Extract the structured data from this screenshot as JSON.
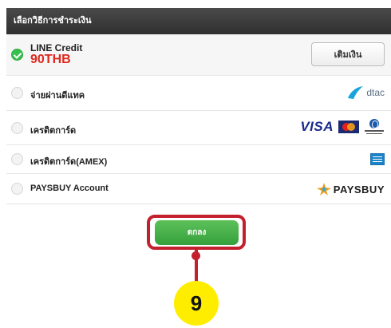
{
  "header": {
    "title": "เลือกวิธีการชำระเงิน"
  },
  "line_credit": {
    "title": "LINE Credit",
    "amount": "90THB",
    "topup_label": "เติมเงิน"
  },
  "options": [
    {
      "label": "จ่ายผ่านดีแทค",
      "logo_text": "dtac"
    },
    {
      "label": "เครดิตการ์ด",
      "logo_text": "VISA"
    },
    {
      "label": "เครดิตการ์ด(AMEX)"
    },
    {
      "label": "PAYSBUY Account",
      "logo_text": "PAYSBUY"
    }
  ],
  "confirm_label": "ตกลง",
  "step_number": "9",
  "colors": {
    "accent_green": "#37c04d",
    "amount_red": "#e0281f",
    "highlight_red": "#c3202d",
    "step_yellow": "#ffed00"
  }
}
